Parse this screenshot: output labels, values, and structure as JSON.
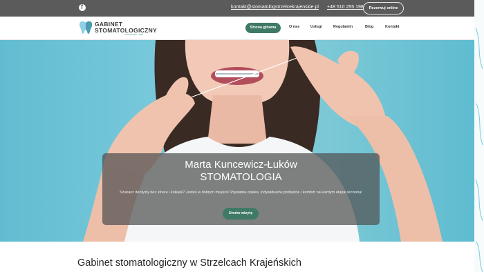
{
  "topbar": {
    "email": "kontakt@stomatologstrzelcekrajenskie.pl",
    "phone": "+48 510 255 198",
    "book_button": "Rezerwuj online",
    "social_icon": "facebook-icon"
  },
  "logo": {
    "line1": "GABINET",
    "line2": "STOMATOLOGICZNY",
    "tagline": "marta kuncewicz - łuków"
  },
  "nav": {
    "items": [
      "Strona główna",
      "O nas",
      "Usługi",
      "Regulamin",
      "Blog",
      "Kontakt"
    ],
    "active_index": 0
  },
  "hero": {
    "title_line1": "Marta Kuncewicz-Łuków",
    "title_line2": "STOMATOLOGIA",
    "text": "Szukasz dentysty bez stresu i kolejek? Jesteś w dobrym miejscu! Prywatna opieka, indywidualne podejście i komfort na każdym etapie leczenia!",
    "button": "Umów wizytę"
  },
  "section": {
    "title": "Gabinet stomatologiczny w Strzelcach Krajeńskich"
  },
  "colors": {
    "topbar_bg": "#5b5b5b",
    "accent_green": "#3f7a66",
    "hero_bg": "#7ccbdc"
  }
}
